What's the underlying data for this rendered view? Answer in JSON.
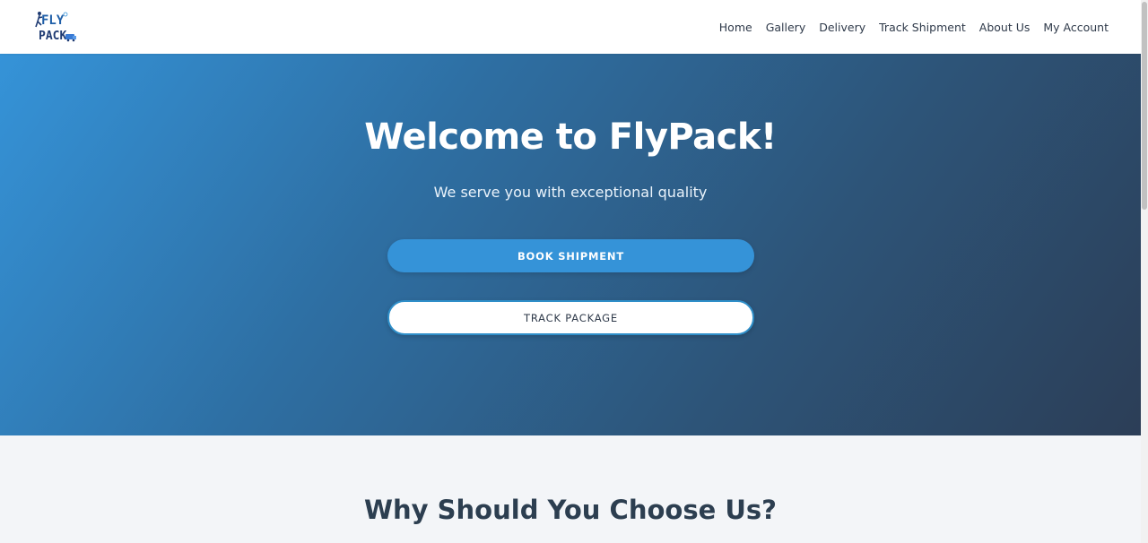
{
  "brand": {
    "logo_line1": "FLY",
    "logo_line2": "PACK",
    "colors": {
      "primary": "#3593d8",
      "dark": "#2c3e50",
      "white": "#ffffff"
    }
  },
  "nav": {
    "items": [
      {
        "label": "Home"
      },
      {
        "label": "Gallery"
      },
      {
        "label": "Delivery"
      },
      {
        "label": "Track Shipment"
      },
      {
        "label": "About Us"
      },
      {
        "label": "My Account"
      }
    ]
  },
  "hero": {
    "title": "Welcome to FlyPack!",
    "subtitle": "We serve you with exceptional quality",
    "book_button": "BOOK SHIPMENT",
    "track_button": "TRACK PACKAGE"
  },
  "why": {
    "title": "Why Should You Choose Us?"
  }
}
